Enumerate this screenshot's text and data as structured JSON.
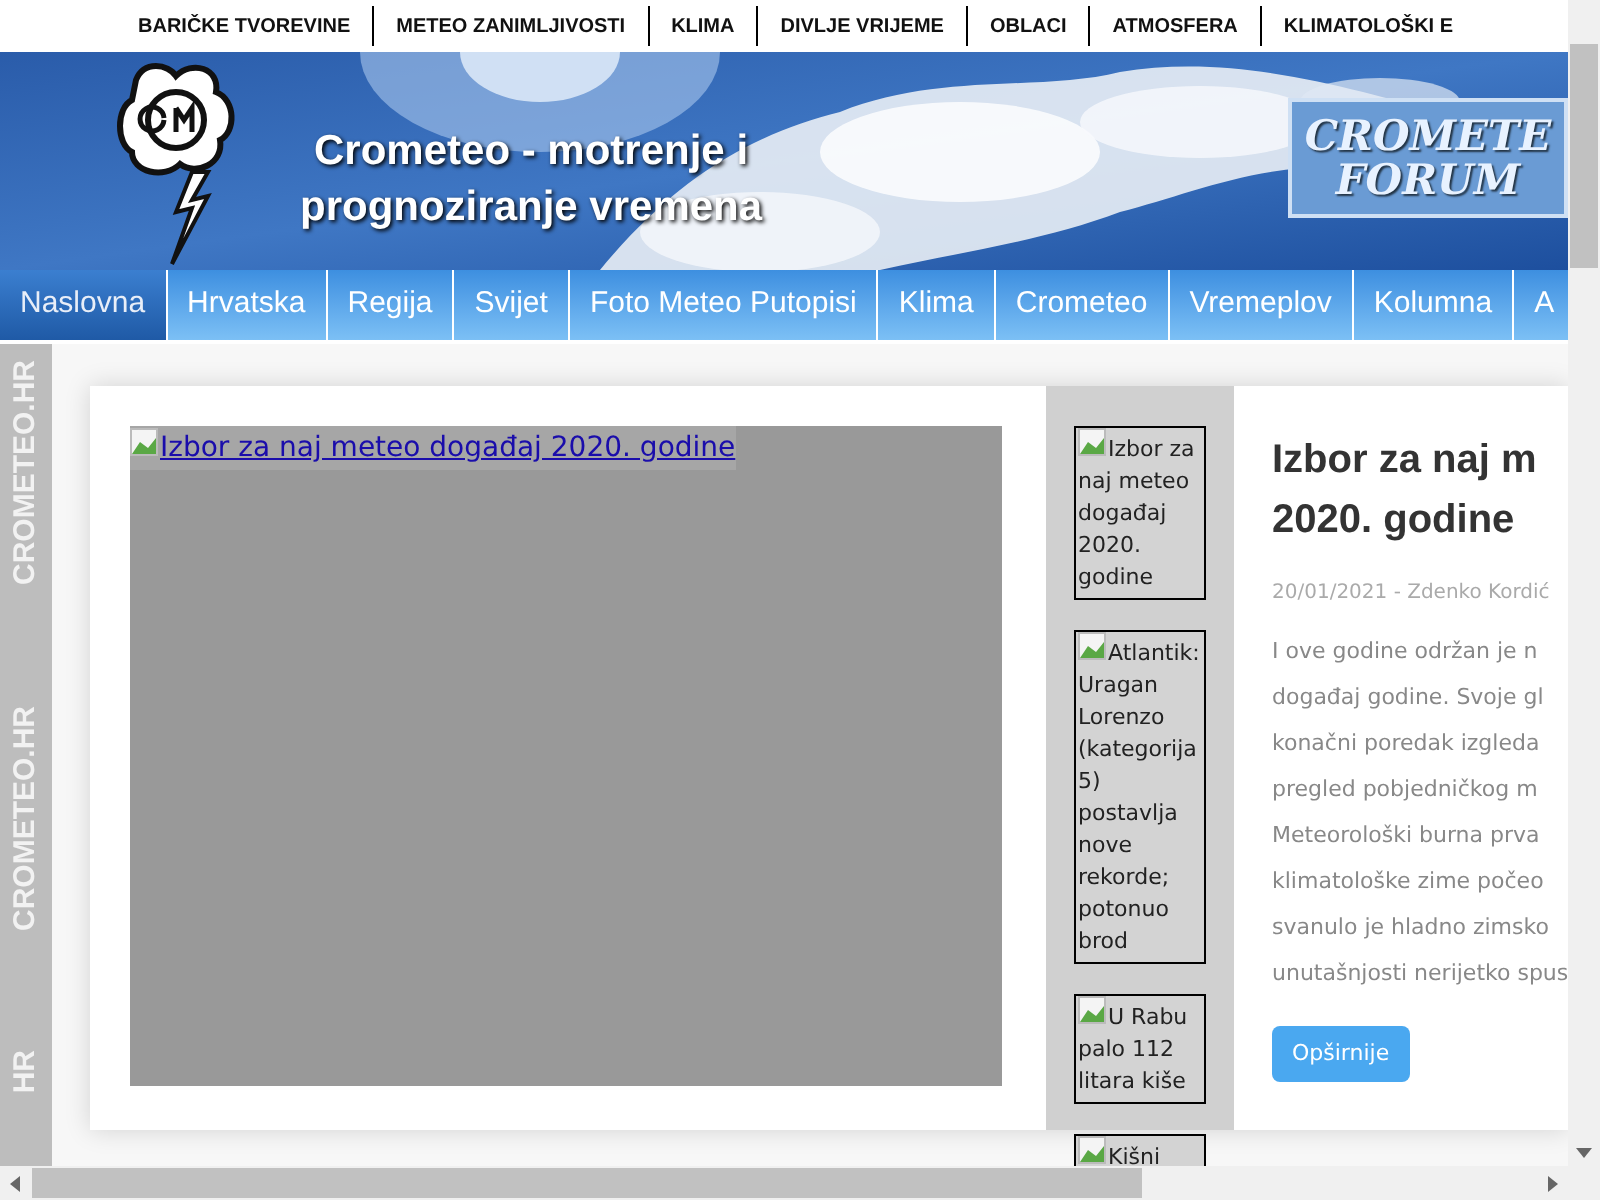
{
  "top_links": [
    "BARIČKE TVOREVINE",
    "METEO ZANIMLJIVOSTI",
    "KLIMA",
    "DIVLJE VRIJEME",
    "OBLACI",
    "ATMOSFERA",
    "KLIMATOLOŠKI E"
  ],
  "header": {
    "title_lines": [
      "Crometeo - motrenje i",
      "prognoziranje vremena"
    ],
    "forum_logo": [
      "CROMETE",
      "FORUM"
    ]
  },
  "nav": [
    {
      "label": "Naslovna",
      "selected": true
    },
    {
      "label": "Hrvatska",
      "selected": false
    },
    {
      "label": "Regija",
      "selected": false
    },
    {
      "label": "Svijet",
      "selected": false
    },
    {
      "label": "Foto Meteo Putopisi",
      "selected": false
    },
    {
      "label": "Klima",
      "selected": false
    },
    {
      "label": "Crometeo",
      "selected": false
    },
    {
      "label": "Vremeplov",
      "selected": false
    },
    {
      "label": "Kolumna",
      "selected": false
    },
    {
      "label": "A",
      "selected": false
    }
  ],
  "watermark": [
    {
      "brand": "CROMETEO.HR"
    },
    {
      "brand": "CROMETEO.HR"
    },
    {
      "brand": "HR"
    }
  ],
  "featured": {
    "image_alt": "Izbor za naj meteo događaj 2020. godine"
  },
  "thumbnails": [
    {
      "alt": "Izbor za naj meteo događaj 2020. godine"
    },
    {
      "alt": "Atlantik: Uragan Lorenzo (kategorija 5) postavlja nove rekorde; potonuo brod"
    },
    {
      "alt": "U Rabu palo 112 litara kiše"
    },
    {
      "alt": "Kišni"
    }
  ],
  "article": {
    "title_lines": [
      "Izbor za naj m",
      "2020. godine"
    ],
    "meta": "20/01/2021 - Zdenko Kordić",
    "lines": [
      "I ove godine održan je n",
      "događaj godine. Svoje gl",
      "konačni poredak izgleda",
      "pregled pobjedničkog m",
      "Meteorološki burna prva",
      "klimatološke zime počeo",
      "svanulo je hladno zimsko",
      "unutašnjosti nerijetko spus"
    ],
    "button": "Opširnije"
  }
}
